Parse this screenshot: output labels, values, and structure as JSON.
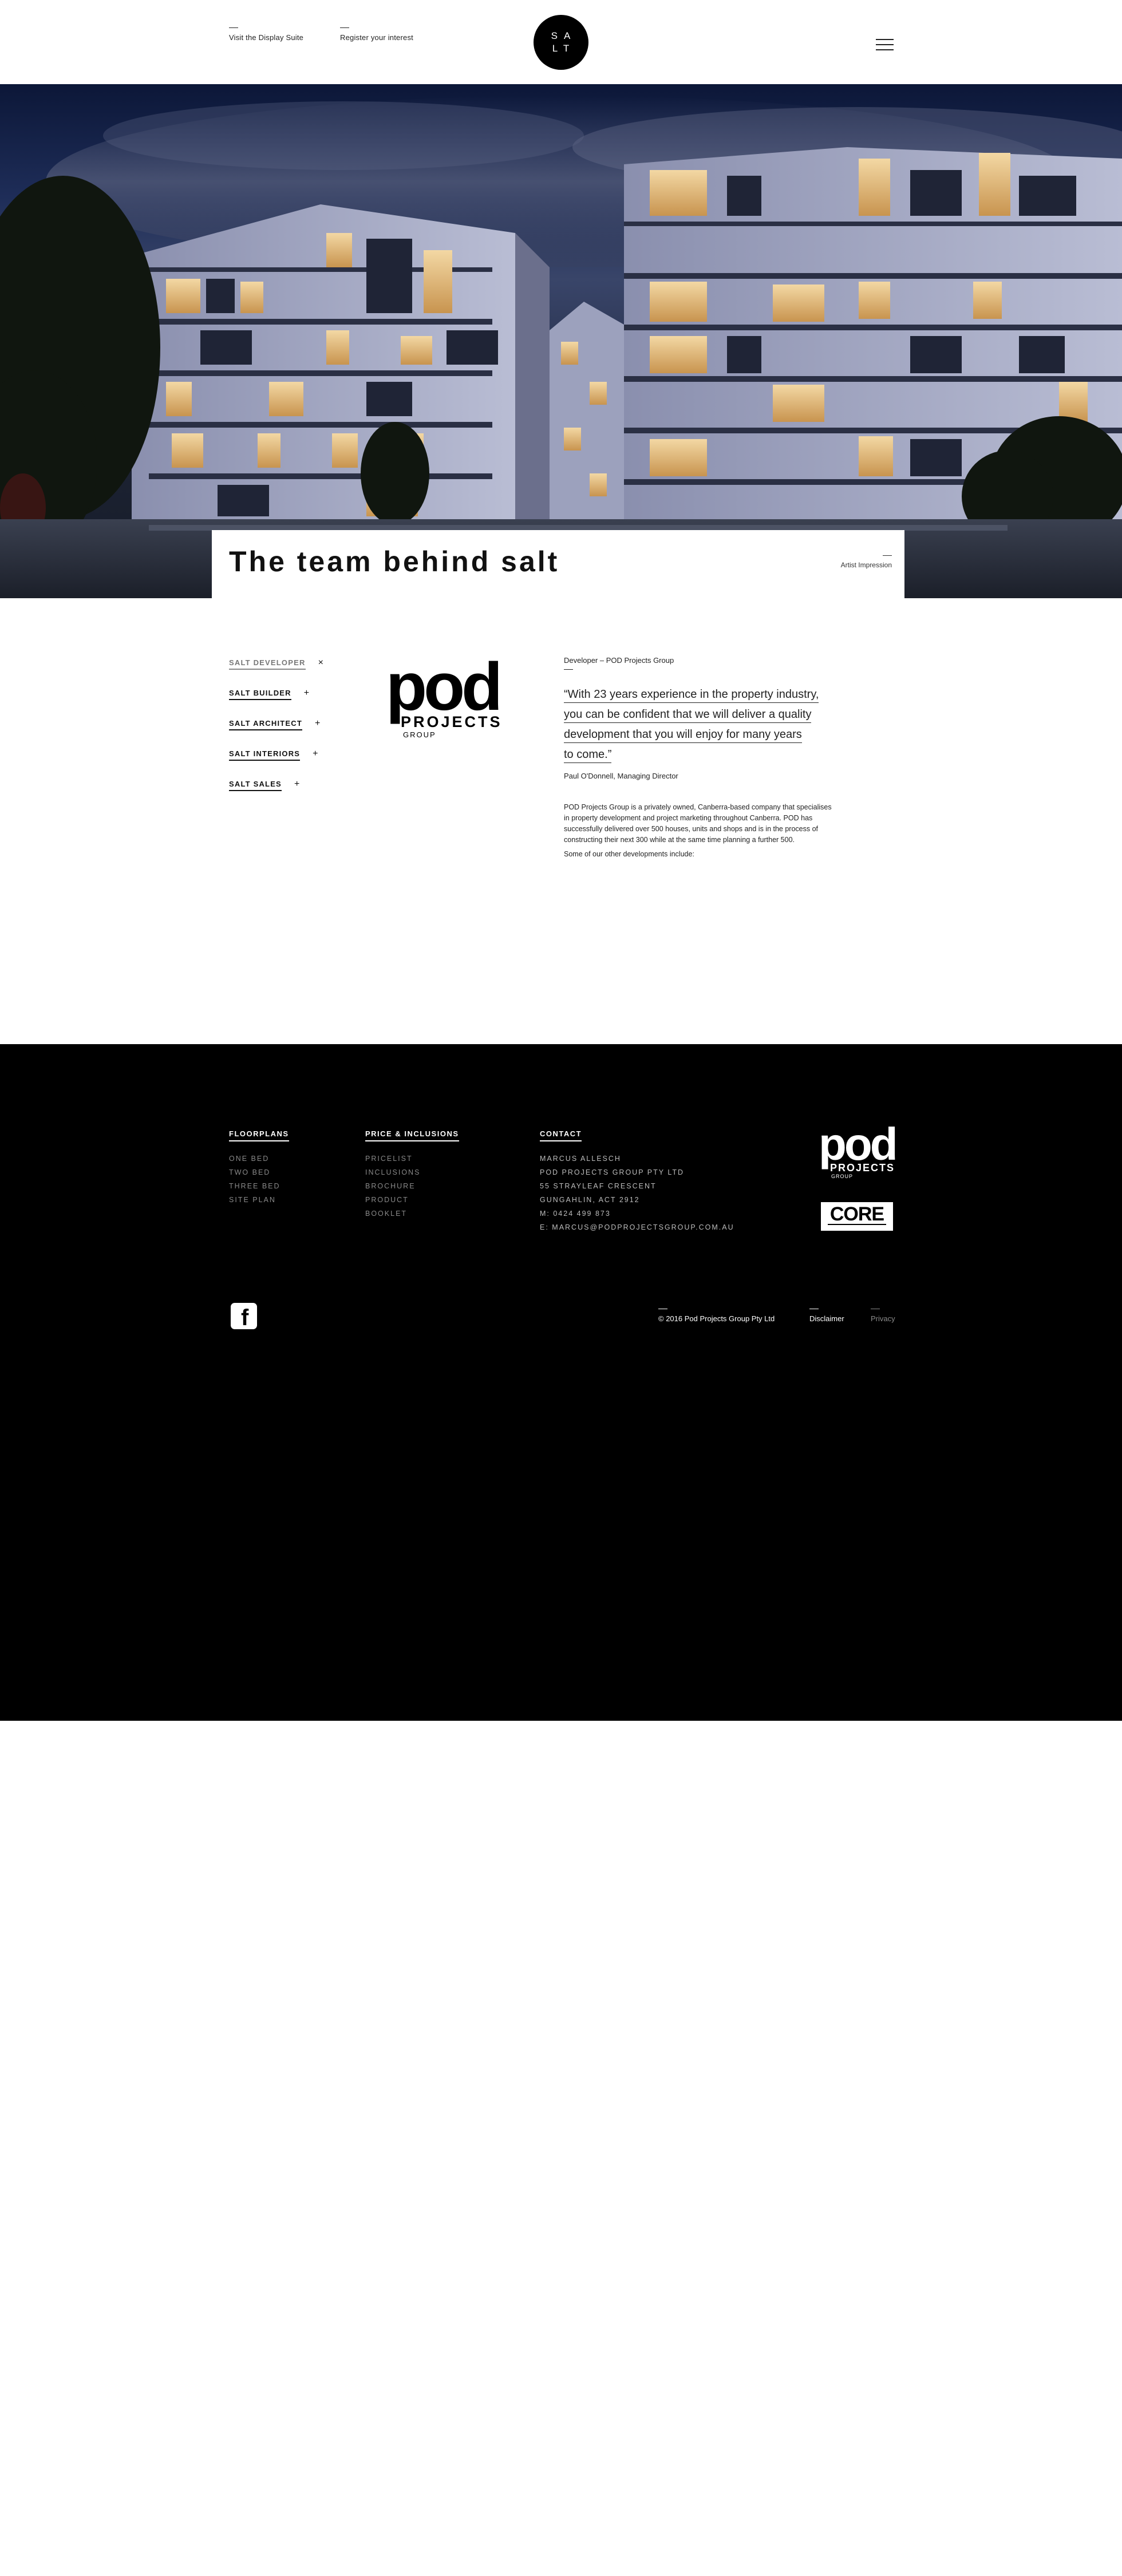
{
  "header": {
    "visit_link": "Visit the Display Suite",
    "register_link": "Register your  interest",
    "logo_line1": "SA",
    "logo_line2": "LT",
    "menu_icon": "hamburger-icon"
  },
  "hero": {
    "title": "The team behind salt",
    "caption": "Artist Impression"
  },
  "team": {
    "nav": [
      {
        "label": "SALT DEVELOPER",
        "symbol": "×"
      },
      {
        "label": "SALT BUILDER",
        "symbol": "+"
      },
      {
        "label": "SALT ARCHITECT",
        "symbol": "+"
      },
      {
        "label": "SALT INTERIORS",
        "symbol": "+"
      },
      {
        "label": "SALT SALES",
        "symbol": "+"
      }
    ],
    "logo": {
      "word": "pod",
      "projects": "PROJECTS",
      "group": "GROUP"
    },
    "developer_label": "Developer – POD Projects Group",
    "quote_lines": [
      "“With 23 years experience in the property industry,",
      "you can be confident that we will deliver a quality",
      "development that you will enjoy for many years",
      "to come.”"
    ],
    "quote_author": "Paul O'Donnell, Managing Director",
    "body_lines": [
      "POD Projects Group is a privately owned, Canberra-based company that specialises",
      "in property development and project marketing throughout Canberra. POD has",
      "successfully delivered over 500 houses, units and shops and is in the process of",
      "constructing their next 300 while at the same time planning a further 500."
    ],
    "body_more": "Some of our other developments include:"
  },
  "footer": {
    "floorplans": {
      "heading": "FLOORPLANS",
      "items": [
        "ONE BED",
        "TWO BED",
        "THREE BED",
        "SITE PLAN"
      ]
    },
    "price": {
      "heading": "PRICE & INCLUSIONS",
      "items": [
        "PRICELIST",
        "INCLUSIONS",
        "BROCHURE",
        "PRODUCT",
        "BOOKLET"
      ]
    },
    "contact": {
      "heading": "CONTACT",
      "items": [
        "MARCUS ALLESCH",
        "POD PROJECTS GROUP PTY LTD",
        "55 STRAYLEAF CRESCENT",
        "GUNGAHLIN, ACT 2912",
        "M: 0424 499 873",
        "E: MARCUS@PODPROJECTSGROUP.COM.AU"
      ]
    },
    "copyright": "© 2016 Pod Projects Group Pty Ltd",
    "disclaimer": "Disclaimer",
    "privacy": "Privacy",
    "pod_logo": {
      "word": "pod",
      "projects": "PROJECTS",
      "group": "GROUP"
    },
    "core_logo": "CORE",
    "facebook_icon": "facebook-icon"
  }
}
